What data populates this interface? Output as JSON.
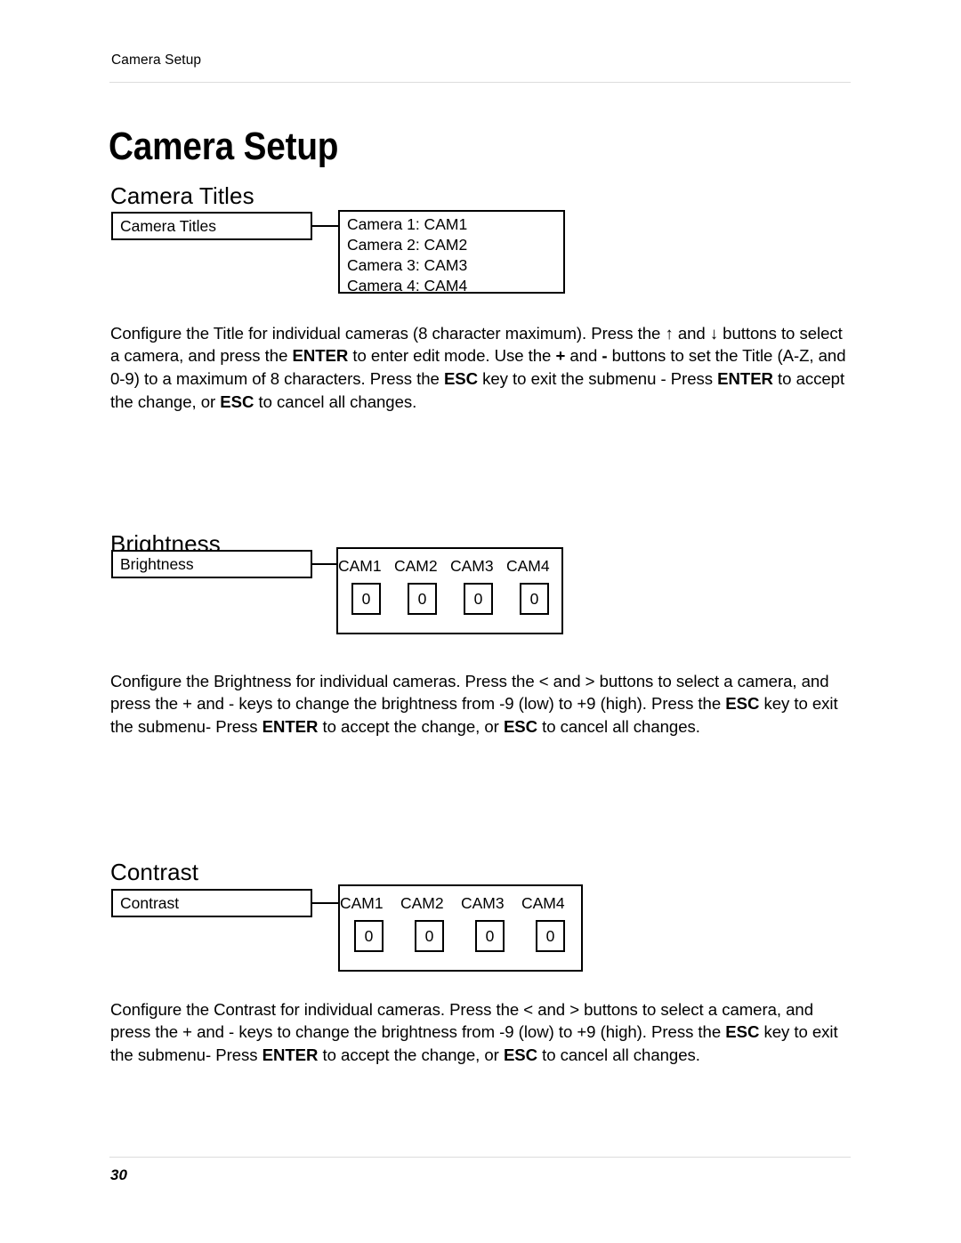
{
  "document": {
    "running_header": "Camera Setup",
    "chapter_title": "Camera Setup",
    "page_number": "30"
  },
  "sections": [
    {
      "heading": "Camera Titles",
      "diagram": {
        "menu_label": "Camera Titles",
        "detail_lines": [
          "Camera 1: CAM1",
          "Camera 2: CAM2",
          "Camera 3: CAM3",
          "Camera 4: CAM4"
        ]
      },
      "paragraph": {
        "t1": "Configure the Title for individual cameras (8 character maximum). Press the ↑ and ↓ buttons to select a camera, and press the ",
        "b1": "ENTER",
        "t2": " to enter edit mode. Use the ",
        "b2": "+",
        "t3": " and ",
        "b3": "-",
        "t4": " buttons to set the Title (A-Z, and 0-9) to a maximum of 8 characters. Press the ",
        "b4": "ESC",
        "t5": " key to exit the submenu - Press ",
        "b5": "ENTER",
        "t6": " to accept the change, or ",
        "b6": "ESC",
        "t7": " to cancel all changes."
      }
    },
    {
      "heading": "Brightness",
      "diagram": {
        "menu_label": "Brightness",
        "columns": [
          "CAM1",
          "CAM2",
          "CAM3",
          "CAM4"
        ],
        "values": [
          "0",
          "0",
          "0",
          "0"
        ]
      },
      "paragraph": {
        "t1": "Configure the Brightness for individual cameras. Press the < and > buttons to select a camera, and press the + and - keys to change the brightness from -9 (low) to +9 (high). Press the ",
        "b1": "ESC",
        "t2": " key to exit the submenu- Press ",
        "b2": "ENTER",
        "t3": " to accept the change, or ",
        "b3": "ESC",
        "t4": " to cancel all changes."
      }
    },
    {
      "heading": "Contrast",
      "diagram": {
        "menu_label": "Contrast",
        "columns": [
          "CAM1",
          "CAM2",
          "CAM3",
          "CAM4"
        ],
        "values": [
          "0",
          "0",
          "0",
          "0"
        ]
      },
      "paragraph": {
        "t1": "Configure the Contrast for individual cameras. Press the < and > buttons to select a camera, and press the + and - keys to change the brightness from -9 (low) to +9 (high). Press the ",
        "b1": "ESC",
        "t2": " key to exit the submenu- Press ",
        "b2": "ENTER",
        "t3": " to accept the change, or ",
        "b3": "ESC",
        "t4": " to cancel all changes."
      }
    }
  ]
}
